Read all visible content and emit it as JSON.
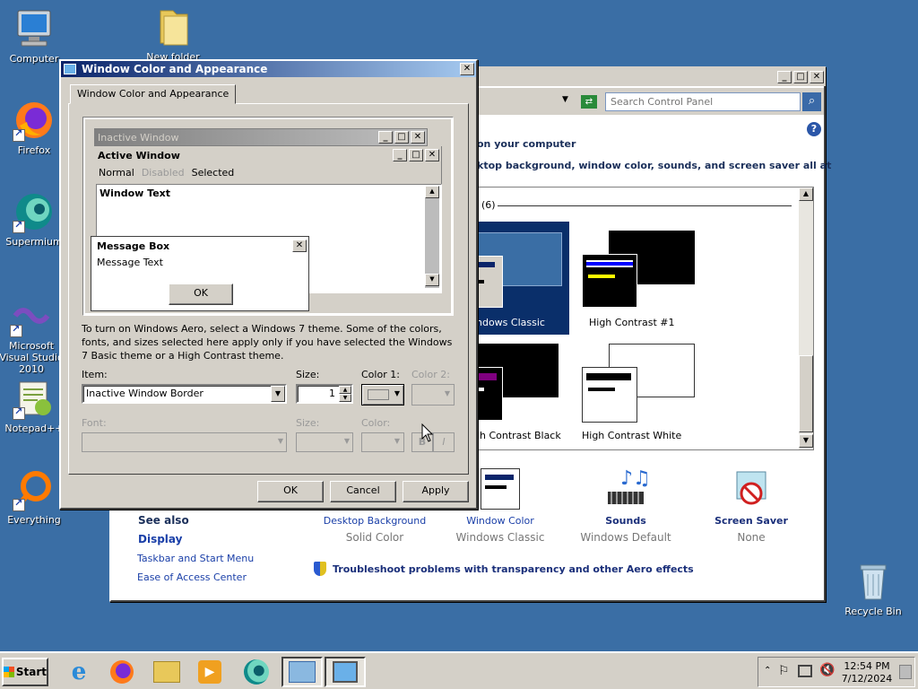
{
  "desktop": {
    "icons": [
      {
        "label": "Computer",
        "icon": "computer-icon"
      },
      {
        "label": "New folder",
        "icon": "folder-icon"
      },
      {
        "label": "Firefox",
        "icon": "firefox-icon"
      },
      {
        "label": "Supermium",
        "icon": "supermium-icon"
      },
      {
        "label": "Microsoft Visual Studio 2010",
        "icon": "visual-studio-icon"
      },
      {
        "label": "Notepad++",
        "icon": "notepad-plus-plus-icon"
      },
      {
        "label": "Everything",
        "icon": "everything-search-icon"
      },
      {
        "label": "Recycle Bin",
        "icon": "recycle-bin-icon"
      }
    ]
  },
  "control_panel": {
    "search_placeholder": "Search Control Panel",
    "heading": "on your computer",
    "subheading": "ktop background, window color, sounds, and screen saver all at",
    "group_label": "(6)",
    "themes": [
      {
        "label": "ndows Classic"
      },
      {
        "label": "High Contrast #1"
      },
      {
        "label": "h Contrast Black"
      },
      {
        "label": "High Contrast White"
      }
    ],
    "bottom_items": [
      {
        "title": "Desktop Background",
        "value": "Solid Color"
      },
      {
        "title": "Window Color",
        "value": "Windows Classic"
      },
      {
        "title": "Sounds",
        "value": "Windows Default"
      },
      {
        "title": "Screen Saver",
        "value": "None"
      }
    ],
    "see_also": {
      "title": "See also",
      "links": [
        "Display",
        "Taskbar and Start Menu",
        "Ease of Access Center"
      ]
    },
    "troubleshoot": "Troubleshoot problems with transparency and other Aero effects"
  },
  "dialog": {
    "title": "Window Color and Appearance",
    "tab": "Window Color and Appearance",
    "preview": {
      "inactive_title": "Inactive Window",
      "active_title": "Active Window",
      "menu": [
        "Normal",
        "Disabled",
        "Selected"
      ],
      "window_text": "Window Text",
      "msgbox_title": "Message Box",
      "msgbox_text": "Message Text",
      "msgbox_ok": "OK"
    },
    "info_text": "To turn on Windows Aero, select a Windows 7 theme.  Some of the colors, fonts, and sizes selected here apply only if you have selected the Windows 7 Basic theme or a High Contrast theme.",
    "item_label": "Item:",
    "item_value": "Inactive Window Border",
    "size_label": "Size:",
    "size_value": "1",
    "color1_label": "Color 1:",
    "color2_label": "Color 2:",
    "font_label": "Font:",
    "font_size_label": "Size:",
    "font_color_label": "Color:",
    "bold_label": "B",
    "italic_label": "I",
    "ok": "OK",
    "cancel": "Cancel",
    "apply": "Apply"
  },
  "taskbar": {
    "start": "Start",
    "apps": [
      "internet-explorer-icon",
      "firefox-icon",
      "file-explorer-icon",
      "media-player-icon",
      "supermium-icon",
      "control-panel-icon",
      "display-settings-icon"
    ],
    "time": "12:54 PM",
    "date": "7/12/2024"
  },
  "colors": {
    "desktop": "#3a6ea5",
    "face": "#d4d0c8",
    "active_title": "#0a246a",
    "link": "#1a3fa8"
  }
}
